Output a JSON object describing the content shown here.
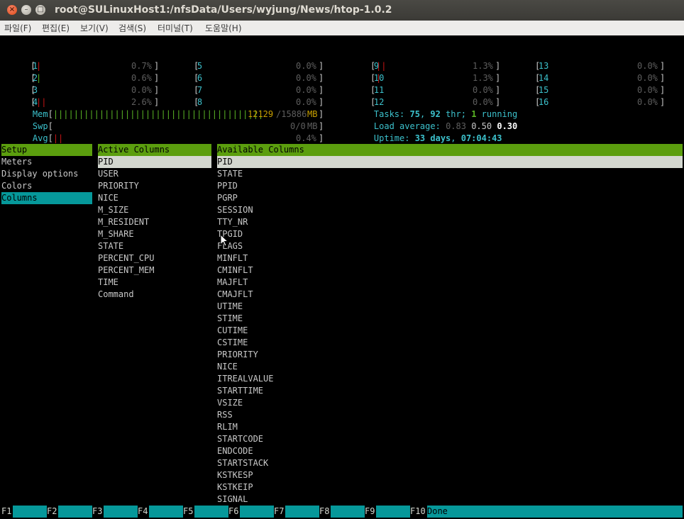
{
  "window": {
    "title": "root@SULinuxHost1:/nfsData/Users/wyjung/News/htop-1.0.2",
    "close_glyph": "×",
    "min_glyph": "–",
    "max_glyph": "□"
  },
  "menu": [
    "파일(F)",
    "편집(E)",
    "보기(V)",
    "검색(S)",
    "터미널(T)",
    "도움말(H)"
  ],
  "cpus": [
    {
      "num": "1",
      "bars": "|",
      "pct": "0.7%"
    },
    {
      "num": "2",
      "bars": "|",
      "pct": "0.6%"
    },
    {
      "num": "3",
      "bars": "",
      "pct": "0.0%"
    },
    {
      "num": "4",
      "bars": "||",
      "pct": "2.6%"
    },
    {
      "num": "5",
      "bars": "",
      "pct": "0.0%"
    },
    {
      "num": "6",
      "bars": "",
      "pct": "0.0%"
    },
    {
      "num": "7",
      "bars": "",
      "pct": "0.0%"
    },
    {
      "num": "8",
      "bars": "",
      "pct": "0.0%"
    },
    {
      "num": "9",
      "bars": "||",
      "pct": "1.3%"
    },
    {
      "num": "10",
      "bars": "|",
      "pct": "1.3%"
    },
    {
      "num": "11",
      "bars": "",
      "pct": "0.0%"
    },
    {
      "num": "12",
      "bars": "",
      "pct": "0.0%"
    },
    {
      "num": "13",
      "bars": "",
      "pct": "0.0%"
    },
    {
      "num": "14",
      "bars": "",
      "pct": "0.0%"
    },
    {
      "num": "15",
      "bars": "",
      "pct": "0.0%"
    },
    {
      "num": "16",
      "bars": "",
      "pct": "0.0%"
    }
  ],
  "mem": {
    "label": "Mem",
    "bars": "|||||||||||||||||||||||||||||||||||||||||",
    "used": "12129",
    "total": "/15886",
    "unit": "MB"
  },
  "swp": {
    "label": "Swp",
    "value": "0/0",
    "unit": "MB"
  },
  "avg": {
    "label": "Avg",
    "bars": "||",
    "pct": "0.4%"
  },
  "tasks": {
    "label": "Tasks: ",
    "count": "75",
    "sep": ", ",
    "thr": "92",
    "thr_label": " thr; ",
    "running": "1",
    "running_label": " running"
  },
  "load": {
    "label": "Load average: ",
    "v1": "0.83",
    "v2": "0.50",
    "v3": "0.30"
  },
  "uptime": {
    "label": "Uptime: ",
    "days_num": "33",
    "days_label": " days",
    "sep": ", ",
    "time": "07:04:43"
  },
  "setup": {
    "header": "Setup",
    "items": [
      "Meters",
      "Display options",
      "Colors",
      "Columns"
    ]
  },
  "active": {
    "header": "Active Columns",
    "items": [
      "PID",
      "USER",
      "PRIORITY",
      "NICE",
      "M_SIZE",
      "M_RESIDENT",
      "M_SHARE",
      "STATE",
      "PERCENT_CPU",
      "PERCENT_MEM",
      "TIME",
      "Command"
    ]
  },
  "available": {
    "header": "Available Columns",
    "items": [
      "PID",
      "STATE",
      "PPID",
      "PGRP",
      "SESSION",
      "TTY_NR",
      "TPGID",
      "FLAGS",
      "MINFLT",
      "CMINFLT",
      "MAJFLT",
      "CMAJFLT",
      "UTIME",
      "STIME",
      "CUTIME",
      "CSTIME",
      "PRIORITY",
      "NICE",
      "ITREALVALUE",
      "STARTTIME",
      "VSIZE",
      "RSS",
      "RLIM",
      "STARTCODE",
      "ENDCODE",
      "STARTSTACK",
      "KSTKESP",
      "KSTKEIP",
      "SIGNAL"
    ]
  },
  "fkeys": [
    {
      "key": "F1",
      "label": ""
    },
    {
      "key": "F2",
      "label": ""
    },
    {
      "key": "F3",
      "label": ""
    },
    {
      "key": "F4",
      "label": ""
    },
    {
      "key": "F5",
      "label": ""
    },
    {
      "key": "F6",
      "label": ""
    },
    {
      "key": "F7",
      "label": ""
    },
    {
      "key": "F8",
      "label": ""
    },
    {
      "key": "F9",
      "label": ""
    },
    {
      "key": "F10",
      "label": "Done"
    }
  ],
  "colors": {
    "terminal_bg": "#000000",
    "header_green": "#5b9e0e",
    "selection_cyan": "#06989a",
    "cyan_text": "#3cc1cc"
  }
}
